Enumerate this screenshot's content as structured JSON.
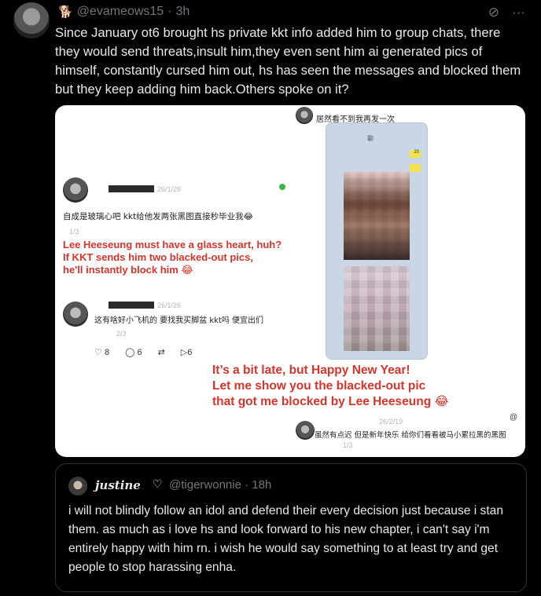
{
  "tweet": {
    "handle": "@evameows15",
    "separator": "·",
    "time": "3h",
    "more_icon": "···",
    "grok_icon": "⊘",
    "text": "Since January ot6 brought hs private kkt info added him to group chats, there they would send threats,insult him,they even sent him ai generated pics of himself, constantly cursed him out, hs has seen the messages and blocked them but they keep adding him back.Others spoke on it?"
  },
  "media": {
    "top_caption_cn": "居然看不到我再发一次",
    "post1": {
      "date": "26/1/26",
      "cn": "自成是玻璃心吧 kkt给他发两张黑图直接秒毕业我😂",
      "page": "1/3",
      "translation_line1": "Lee Heeseung must have a glass heart, huh?",
      "translation_line2": "If KKT sends him two blacked-out pics,",
      "translation_line3": "he'll instantly block him 😂"
    },
    "post2": {
      "date": "26/1/26",
      "cn": "这有啥好小飞机的 要找我买脚盆 kkt吗 便宜出们",
      "page": "2/3",
      "likes": "8",
      "comments": "6",
      "shares": "6"
    },
    "phone": {
      "header": "聊",
      "chip": "20"
    },
    "post3": {
      "translation_line1": "It’s a bit late, but Happy New Year!",
      "translation_line2": "Let me show you the blacked-out pic",
      "translation_line3": "that got me blocked by Lee Heeseung 😂",
      "date": "26/2/19",
      "cn": "虽然有点迟 但是新年快乐 给你们看看被马小累拉黑的黑图",
      "page": "1/3"
    }
  },
  "quote": {
    "name": "justine",
    "heart": "♡",
    "handle": "@tigerwonnie",
    "separator": "·",
    "time": "18h",
    "text": "i will not blindly follow an idol and defend their every decision just because i stan them. as much as i love hs and look forward to his new chapter, i can't say i'm entirely happy with him rn. i wish he would say something to at least try and get people to stop harassing enha."
  }
}
